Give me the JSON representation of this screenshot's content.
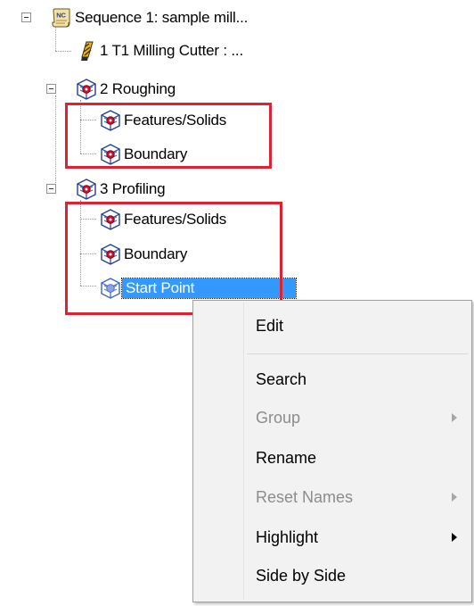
{
  "tree": {
    "nodes": [
      {
        "id": "seq",
        "label": "Sequence 1: sample mill...",
        "icon": "nc-sequence-icon",
        "expanded": true
      },
      {
        "id": "tool",
        "label": "1 T1 Milling Cutter : ...",
        "icon": "milling-cutter-icon"
      },
      {
        "id": "rough",
        "label": "2 Roughing",
        "icon": "toolpath-operation-icon",
        "expanded": true
      },
      {
        "id": "rough-feat",
        "label": "Features/Solids",
        "icon": "features-solids-icon"
      },
      {
        "id": "rough-bound",
        "label": "Boundary",
        "icon": "boundary-icon"
      },
      {
        "id": "prof",
        "label": "3 Profiling",
        "icon": "toolpath-operation-icon",
        "expanded": true
      },
      {
        "id": "prof-feat",
        "label": "Features/Solids",
        "icon": "features-solids-icon"
      },
      {
        "id": "prof-bound",
        "label": "Boundary",
        "icon": "boundary-icon"
      },
      {
        "id": "prof-start",
        "label": "Start Point",
        "icon": "start-point-icon",
        "selected": true
      }
    ]
  },
  "context_menu": {
    "items": [
      {
        "label": "Edit",
        "enabled": true,
        "submenu": false
      },
      {
        "label": "Search",
        "enabled": true,
        "submenu": false
      },
      {
        "label": "Group",
        "enabled": false,
        "submenu": true
      },
      {
        "label": "Rename",
        "enabled": true,
        "submenu": false
      },
      {
        "label": "Reset Names",
        "enabled": false,
        "submenu": true
      },
      {
        "label": "Highlight",
        "enabled": true,
        "submenu": true
      },
      {
        "label": "Side by Side",
        "enabled": true,
        "submenu": false
      }
    ]
  },
  "colors": {
    "highlight_box": "#e0212f",
    "selection": "#3399ff",
    "menu_background": "#f2f2f2",
    "disabled_text": "#8c8c8c"
  }
}
